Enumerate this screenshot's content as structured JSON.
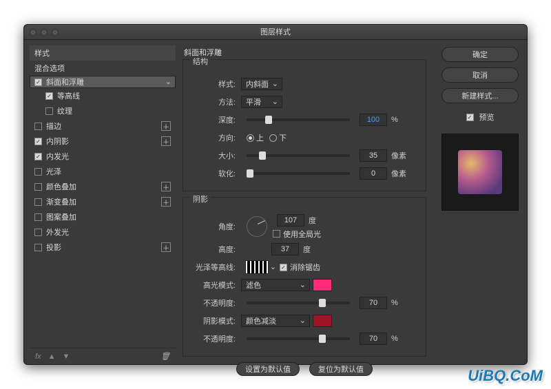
{
  "window": {
    "title": "图层样式"
  },
  "sidebar": {
    "styles": "样式",
    "blend": "混合选项",
    "items": [
      {
        "label": "斜面和浮雕",
        "checked": true,
        "selected": true
      },
      {
        "label": "等高线",
        "checked": true,
        "sub": true
      },
      {
        "label": "纹理",
        "checked": false,
        "sub": true
      },
      {
        "label": "描边",
        "checked": false,
        "plus": true
      },
      {
        "label": "内阴影",
        "checked": true,
        "plus": true
      },
      {
        "label": "内发光",
        "checked": true
      },
      {
        "label": "光泽",
        "checked": false
      },
      {
        "label": "颜色叠加",
        "checked": false,
        "plus": true
      },
      {
        "label": "渐变叠加",
        "checked": false,
        "plus": true
      },
      {
        "label": "图案叠加",
        "checked": false
      },
      {
        "label": "外发光",
        "checked": false
      },
      {
        "label": "投影",
        "checked": false,
        "plus": true
      }
    ],
    "fx": "fx"
  },
  "panel": {
    "heading": "斜面和浮雕",
    "structure": {
      "title": "结构",
      "style_l": "样式:",
      "style_v": "内斜面",
      "tech_l": "方法:",
      "tech_v": "平滑",
      "depth_l": "深度:",
      "depth_v": "100",
      "depth_u": "%",
      "dir_l": "方向:",
      "up": "上",
      "down": "下",
      "size_l": "大小:",
      "size_v": "35",
      "size_u": "像素",
      "soft_l": "软化:",
      "soft_v": "0",
      "soft_u": "像素"
    },
    "shade": {
      "title": "阴影",
      "angle_l": "角度:",
      "angle_v": "107",
      "deg": "度",
      "global": "使用全局光",
      "alt_l": "高度:",
      "alt_v": "37",
      "gloss_l": "光泽等高线:",
      "aa": "消除锯齿",
      "hmode_l": "高光模式:",
      "hmode_v": "滤色",
      "hcolor": "#ff2a7a",
      "hop_l": "不透明度:",
      "hop_v": "70",
      "smode_l": "阴影模式:",
      "smode_v": "颜色减淡",
      "scolor": "#a01226",
      "sop_l": "不透明度:",
      "sop_v": "70",
      "pct": "%"
    },
    "default": "设置为默认值",
    "reset": "复位为默认值"
  },
  "right": {
    "ok": "确定",
    "cancel": "取消",
    "newstyle": "新建样式...",
    "preview": "预览"
  },
  "watermark": "UiBQ.CoM"
}
